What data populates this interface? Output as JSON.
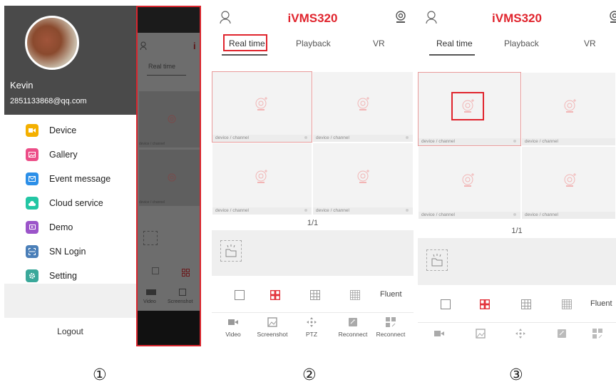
{
  "panel1": {
    "user": {
      "name": "Kevin",
      "email": "2851133868@qq.com"
    },
    "menu": [
      {
        "label": "Device",
        "color": "#f4b000",
        "icon": "video-icon"
      },
      {
        "label": "Gallery",
        "color": "#ec4d87",
        "icon": "gallery-icon"
      },
      {
        "label": "Event message",
        "color": "#2c8fe8",
        "icon": "mail-icon"
      },
      {
        "label": "Cloud service",
        "color": "#23c6a4",
        "icon": "cloud-icon"
      },
      {
        "label": "Demo",
        "color": "#9b54c9",
        "icon": "demo-icon"
      },
      {
        "label": "SN Login",
        "color": "#4b7fb8",
        "icon": "scan-icon"
      },
      {
        "label": "Setting",
        "color": "#3aa89a",
        "icon": "gear-icon"
      }
    ],
    "logout": "Logout",
    "dimmed": {
      "tab": "Real time",
      "caption": "device / channel",
      "toolbar": [
        "Video",
        "Screenshot"
      ]
    }
  },
  "panel2": {
    "brand": "iVMS320",
    "tabs": [
      "Real time",
      "Playback",
      "VR"
    ],
    "cells": [
      "device / channel",
      "device / channel",
      "device / channel",
      "device / channel"
    ],
    "page": "1/1",
    "quality": "Fluent",
    "toolbar": [
      "Video",
      "Screenshot",
      "PTZ",
      "Reconnect",
      "Reconnect"
    ]
  },
  "panel3": {
    "brand": "iVMS320",
    "tabs": [
      "Real time",
      "Playback",
      "VR"
    ],
    "cells": [
      "device / channel",
      "device / channel",
      "device / channel",
      "device / channel"
    ],
    "page": "1/1",
    "quality": "Fluent"
  },
  "labels": [
    "①",
    "②",
    "③"
  ],
  "colors": {
    "accent": "#e0242d",
    "drawer_header": "#4a4a4a"
  }
}
